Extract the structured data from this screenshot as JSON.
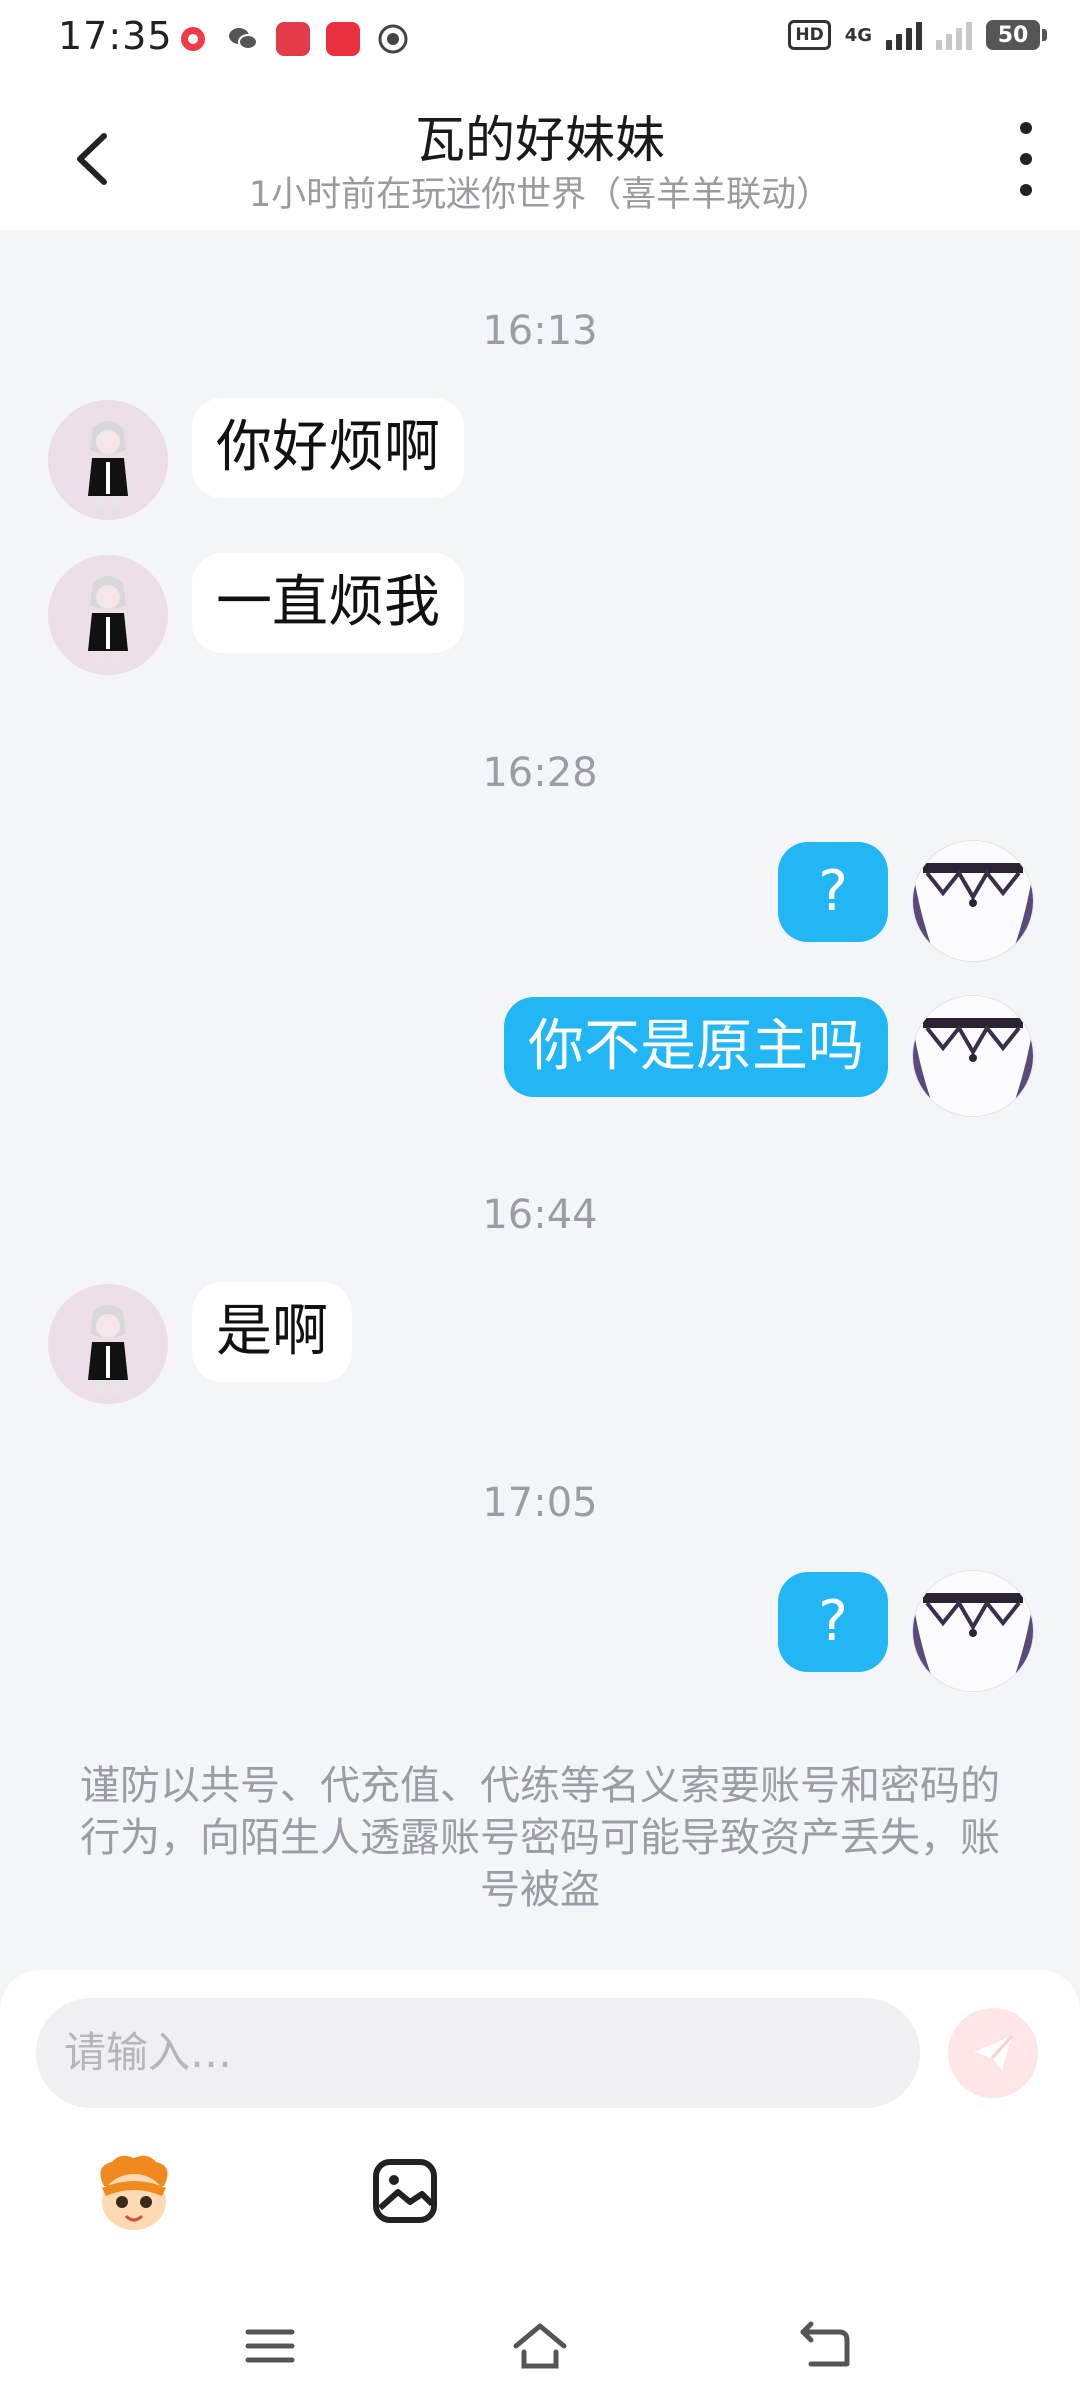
{
  "status_bar": {
    "time": "17:35",
    "app_icons": [
      "record-app-icon",
      "wechat-icon",
      "mall-app-icon",
      "shop-app-icon",
      "camera-app-icon"
    ],
    "hd_label": "HD",
    "network_label": "4G",
    "battery": "50"
  },
  "header": {
    "back_icon": "chevron-left-icon",
    "title": "瓦的好妹妹",
    "subtitle": "1小时前在玩迷你世界（喜羊羊联动）",
    "more_icon": "more-vertical-icon"
  },
  "messages": [
    {
      "type": "timestamp",
      "text": "16:13"
    },
    {
      "type": "incoming",
      "text": "你好烦啊"
    },
    {
      "type": "incoming",
      "text": "一直烦我"
    },
    {
      "type": "timestamp",
      "text": "16:28"
    },
    {
      "type": "outgoing",
      "text": "?"
    },
    {
      "type": "outgoing",
      "text": "你不是原主吗"
    },
    {
      "type": "timestamp",
      "text": "16:44"
    },
    {
      "type": "incoming",
      "text": "是啊"
    },
    {
      "type": "timestamp",
      "text": "17:05"
    },
    {
      "type": "outgoing",
      "text": "?"
    }
  ],
  "security_notice": "谨防以共号、代充值、代练等名义索要账号和密码的行为，向陌生人透露账号密码可能导致资产丢失，账号被盗",
  "input": {
    "placeholder": "请输入…",
    "send_icon": "send-icon",
    "emoji_icon": "emoji-mascot-icon",
    "image_icon": "image-icon"
  },
  "nav_bar": [
    "menu-icon",
    "home-icon",
    "back-icon"
  ],
  "colors": {
    "outgoing_bubble": "#23b6f5",
    "incoming_bubble": "#ffffff",
    "background": "#f3f5f9",
    "send_button": "#ffe5e5"
  }
}
